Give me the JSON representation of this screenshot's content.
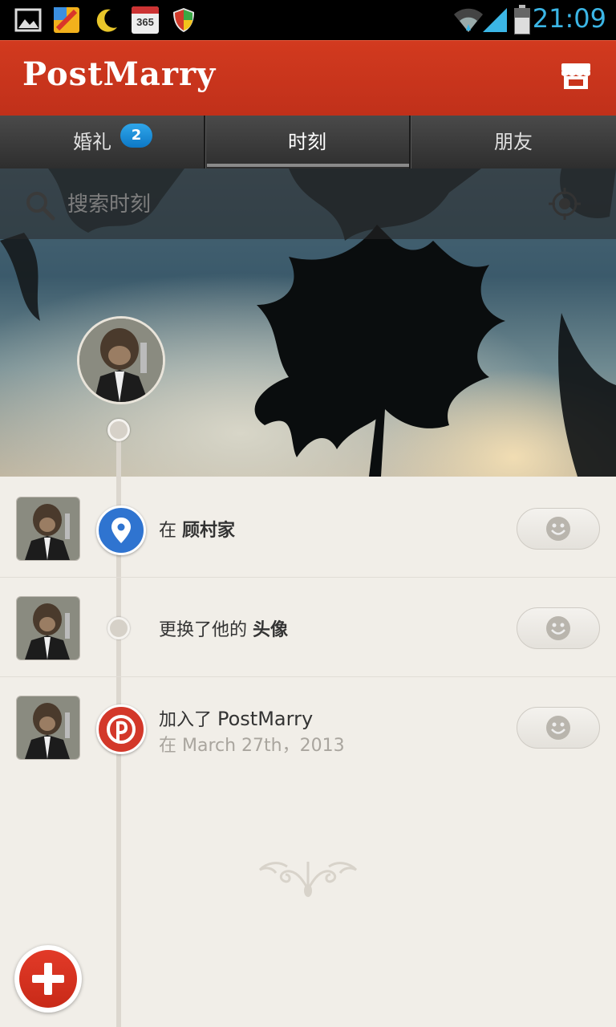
{
  "status_bar": {
    "time": "21:09",
    "left_icons": [
      "gallery-icon",
      "color-app-icon",
      "moon-icon",
      "calendar-365-icon",
      "shield-icon"
    ],
    "calendar_label": "365",
    "right_icons": [
      "wifi-icon",
      "signal-icon",
      "battery-icon"
    ]
  },
  "app_bar": {
    "title": "PostMarry",
    "shop_icon": "store-icon"
  },
  "tabs": [
    {
      "label": "婚礼",
      "badge": "2",
      "selected": false
    },
    {
      "label": "时刻",
      "selected": true
    },
    {
      "label": "朋友",
      "selected": false
    }
  ],
  "search": {
    "placeholder": "搜索时刻",
    "search_icon": "search-icon",
    "location_icon": "locate-icon"
  },
  "timeline": [
    {
      "text_prefix": "在 ",
      "text_bold": "顾村家",
      "marker": "location-pin-icon",
      "marker_color": "#2f74d0"
    },
    {
      "text_prefix": "更换了他的 ",
      "text_bold": "头像",
      "marker": "small-dot"
    },
    {
      "text_prefix": "加入了 ",
      "text_bold": "PostMarry",
      "subtext": "在 March 27th，2013",
      "marker": "postmarry-logo-icon",
      "marker_color": "#d3382a"
    }
  ],
  "colors": {
    "app_bar": "#c9341c",
    "accent_blue": "#3bb6e6",
    "background": "#f1eee8"
  }
}
